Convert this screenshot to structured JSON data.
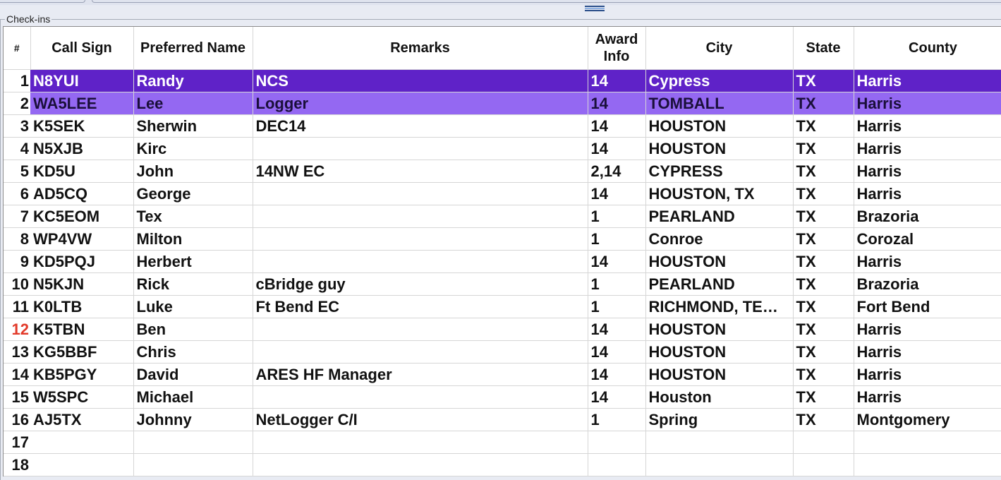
{
  "group_title": "Check-ins",
  "columns": [
    {
      "key": "num",
      "label": "#"
    },
    {
      "key": "call",
      "label": "Call Sign"
    },
    {
      "key": "name",
      "label": "Preferred Name"
    },
    {
      "key": "remarks",
      "label": "Remarks"
    },
    {
      "key": "award",
      "label": "Award Info"
    },
    {
      "key": "city",
      "label": "City"
    },
    {
      "key": "state",
      "label": "State"
    },
    {
      "key": "county",
      "label": "County"
    }
  ],
  "rows": [
    {
      "num": "1",
      "call": "N8YUI",
      "name": "Randy",
      "remarks": "NCS",
      "award": "14",
      "city": "Cypress",
      "state": "TX",
      "county": "Harris",
      "highlight": "primary"
    },
    {
      "num": "2",
      "call": "WA5LEE",
      "name": "Lee",
      "remarks": "Logger",
      "award": "14",
      "city": "TOMBALL",
      "state": "TX",
      "county": "Harris",
      "highlight": "secondary"
    },
    {
      "num": "3",
      "call": "K5SEK",
      "name": "Sherwin",
      "remarks": "DEC14",
      "award": "14",
      "city": "HOUSTON",
      "state": "TX",
      "county": "Harris"
    },
    {
      "num": "4",
      "call": "N5XJB",
      "name": "Kirc",
      "remarks": "",
      "award": "14",
      "city": "HOUSTON",
      "state": "TX",
      "county": "Harris"
    },
    {
      "num": "5",
      "call": "KD5U",
      "name": "John",
      "remarks": "14NW EC",
      "award": "2,14",
      "city": "CYPRESS",
      "state": "TX",
      "county": "Harris"
    },
    {
      "num": "6",
      "call": "AD5CQ",
      "name": "George",
      "remarks": "",
      "award": "14",
      "city": "HOUSTON, TX",
      "state": "TX",
      "county": "Harris"
    },
    {
      "num": "7",
      "call": "KC5EOM",
      "name": "Tex",
      "remarks": "",
      "award": "1",
      "city": "PEARLAND",
      "state": "TX",
      "county": "Brazoria"
    },
    {
      "num": "8",
      "call": "WP4VW",
      "name": "Milton",
      "remarks": "",
      "award": "1",
      "city": "Conroe",
      "state": "TX",
      "county": "Corozal"
    },
    {
      "num": "9",
      "call": "KD5PQJ",
      "name": "Herbert",
      "remarks": "",
      "award": "14",
      "city": "HOUSTON",
      "state": "TX",
      "county": "Harris"
    },
    {
      "num": "10",
      "call": "N5KJN",
      "name": "Rick",
      "remarks": "cBridge guy",
      "award": "1",
      "city": "PEARLAND",
      "state": "TX",
      "county": "Brazoria"
    },
    {
      "num": "11",
      "call": "K0LTB",
      "name": "Luke",
      "remarks": "Ft Bend EC",
      "award": "1",
      "city": "RICHMOND, TE…",
      "state": "TX",
      "county": "Fort Bend"
    },
    {
      "num": "12",
      "call": "K5TBN",
      "name": "Ben",
      "remarks": "",
      "award": "14",
      "city": "HOUSTON",
      "state": "TX",
      "county": "Harris",
      "num_alert": true
    },
    {
      "num": "13",
      "call": "KG5BBF",
      "name": "Chris",
      "remarks": "",
      "award": "14",
      "city": "HOUSTON",
      "state": "TX",
      "county": "Harris"
    },
    {
      "num": "14",
      "call": "KB5PGY",
      "name": "David",
      "remarks": "ARES HF Manager",
      "award": "14",
      "city": "HOUSTON",
      "state": "TX",
      "county": "Harris"
    },
    {
      "num": "15",
      "call": "W5SPC",
      "name": "Michael",
      "remarks": "",
      "award": "14",
      "city": "Houston",
      "state": "TX",
      "county": "Harris"
    },
    {
      "num": "16",
      "call": "AJ5TX",
      "name": "Johnny",
      "remarks": "NetLogger C/I",
      "award": "1",
      "city": "Spring",
      "state": "TX",
      "county": "Montgomery"
    },
    {
      "num": "17",
      "call": "",
      "name": "",
      "remarks": "",
      "award": "",
      "city": "",
      "state": "",
      "county": ""
    },
    {
      "num": "18",
      "call": "",
      "name": "",
      "remarks": "",
      "award": "",
      "city": "",
      "state": "",
      "county": ""
    }
  ],
  "colors": {
    "primary_selection": "#5f22c8",
    "secondary_selection": "#9468f2",
    "alert_row_number": "#e23a2a"
  }
}
